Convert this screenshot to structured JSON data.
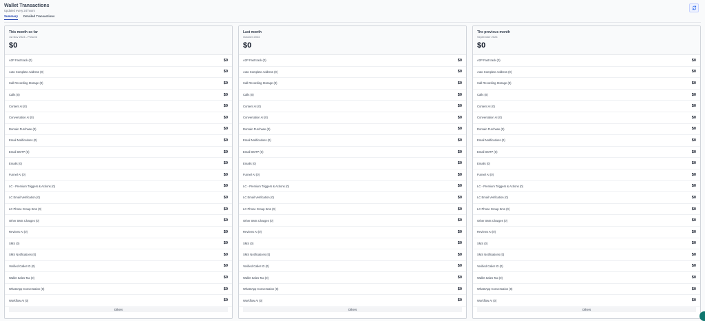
{
  "header": {
    "title": "Wallet Transactions",
    "subtitle": "Updated every 24 hours",
    "refresh_icon": "refresh-icon"
  },
  "tabs": [
    {
      "label": "Summary",
      "active": true
    },
    {
      "label": "Detailed Transactions",
      "active": false
    }
  ],
  "cards": [
    {
      "period": "This month so far",
      "range": "1st Nov 2024 - Present",
      "total": "$0",
      "rows": [
        {
          "label": "A2P Fast track (0)",
          "amount": "$0"
        },
        {
          "label": "Auto Complete Address (0)",
          "amount": "$0"
        },
        {
          "label": "Call Recording Storage (0)",
          "amount": "$0"
        },
        {
          "label": "Calls (0)",
          "amount": "$0"
        },
        {
          "label": "Content AI (0)",
          "amount": "$0"
        },
        {
          "label": "Conversation AI (0)",
          "amount": "$0"
        },
        {
          "label": "Domain Purchase (0)",
          "amount": "$0"
        },
        {
          "label": "Email Notifications (0)",
          "amount": "$0"
        },
        {
          "label": "Email SMTP (0)",
          "amount": "$0"
        },
        {
          "label": "Emails (0)",
          "amount": "$0"
        },
        {
          "label": "Funnel AI (0)",
          "amount": "$0"
        },
        {
          "label": "LC - Premium Triggers & Actions (0)",
          "amount": "$0"
        },
        {
          "label": "LC Email Verification (0)",
          "amount": "$0"
        },
        {
          "label": "LC Phone Group Sms (0)",
          "amount": "$0"
        },
        {
          "label": "Other SMS Charges (0)",
          "amount": "$0"
        },
        {
          "label": "Reviews AI (0)",
          "amount": "$0"
        },
        {
          "label": "SMS (0)",
          "amount": "$0"
        },
        {
          "label": "SMS Notifications (0)",
          "amount": "$0"
        },
        {
          "label": "Verified Caller ID (0)",
          "amount": "$0"
        },
        {
          "label": "Wallet Sales Tax (0)",
          "amount": "$0"
        },
        {
          "label": "WhatsApp Conversation (0)",
          "amount": "$0"
        },
        {
          "label": "Workflow AI (0)",
          "amount": "$0"
        }
      ],
      "others_label": "Others"
    },
    {
      "period": "Last month",
      "range": "October 2024",
      "total": "$0",
      "rows": [
        {
          "label": "A2P Fast track (0)",
          "amount": "$0"
        },
        {
          "label": "Auto Complete Address (0)",
          "amount": "$0"
        },
        {
          "label": "Call Recording Storage (0)",
          "amount": "$0"
        },
        {
          "label": "Calls (0)",
          "amount": "$0"
        },
        {
          "label": "Content AI (0)",
          "amount": "$0"
        },
        {
          "label": "Conversation AI (0)",
          "amount": "$0"
        },
        {
          "label": "Domain Purchase (0)",
          "amount": "$0"
        },
        {
          "label": "Email Notifications (0)",
          "amount": "$0"
        },
        {
          "label": "Email SMTP (0)",
          "amount": "$0"
        },
        {
          "label": "Emails (0)",
          "amount": "$0"
        },
        {
          "label": "Funnel AI (0)",
          "amount": "$0"
        },
        {
          "label": "LC - Premium Triggers & Actions (0)",
          "amount": "$0"
        },
        {
          "label": "LC Email Verification (0)",
          "amount": "$0"
        },
        {
          "label": "LC Phone Group Sms (0)",
          "amount": "$0"
        },
        {
          "label": "Other SMS Charges (0)",
          "amount": "$0"
        },
        {
          "label": "Reviews AI (0)",
          "amount": "$0"
        },
        {
          "label": "SMS (0)",
          "amount": "$0"
        },
        {
          "label": "SMS Notifications (0)",
          "amount": "$0"
        },
        {
          "label": "Verified Caller ID (0)",
          "amount": "$0"
        },
        {
          "label": "Wallet Sales Tax (0)",
          "amount": "$0"
        },
        {
          "label": "WhatsApp Conversation (0)",
          "amount": "$0"
        },
        {
          "label": "Workflow AI (0)",
          "amount": "$0"
        }
      ],
      "others_label": "Others"
    },
    {
      "period": "The previous month",
      "range": "September 2024",
      "total": "$0",
      "rows": [
        {
          "label": "A2P Fast track (0)",
          "amount": "$0"
        },
        {
          "label": "Auto Complete Address (0)",
          "amount": "$0"
        },
        {
          "label": "Call Recording Storage (0)",
          "amount": "$0"
        },
        {
          "label": "Calls (0)",
          "amount": "$0"
        },
        {
          "label": "Content AI (0)",
          "amount": "$0"
        },
        {
          "label": "Conversation AI (0)",
          "amount": "$0"
        },
        {
          "label": "Domain Purchase (0)",
          "amount": "$0"
        },
        {
          "label": "Email Notifications (0)",
          "amount": "$0"
        },
        {
          "label": "Email SMTP (0)",
          "amount": "$0"
        },
        {
          "label": "Emails (0)",
          "amount": "$0"
        },
        {
          "label": "Funnel AI (0)",
          "amount": "$0"
        },
        {
          "label": "LC - Premium Triggers & Actions (0)",
          "amount": "$0"
        },
        {
          "label": "LC Email Verification (0)",
          "amount": "$0"
        },
        {
          "label": "LC Phone Group Sms (0)",
          "amount": "$0"
        },
        {
          "label": "Other SMS Charges (0)",
          "amount": "$0"
        },
        {
          "label": "Reviews AI (0)",
          "amount": "$0"
        },
        {
          "label": "SMS (0)",
          "amount": "$0"
        },
        {
          "label": "SMS Notifications (0)",
          "amount": "$0"
        },
        {
          "label": "Verified Caller ID (0)",
          "amount": "$0"
        },
        {
          "label": "Wallet Sales Tax (0)",
          "amount": "$0"
        },
        {
          "label": "WhatsApp Conversation (0)",
          "amount": "$0"
        },
        {
          "label": "Workflow AI (0)",
          "amount": "$0"
        }
      ],
      "others_label": "Others"
    }
  ],
  "colors": {
    "accent": "#1e40af",
    "fab": "#0f766e"
  }
}
